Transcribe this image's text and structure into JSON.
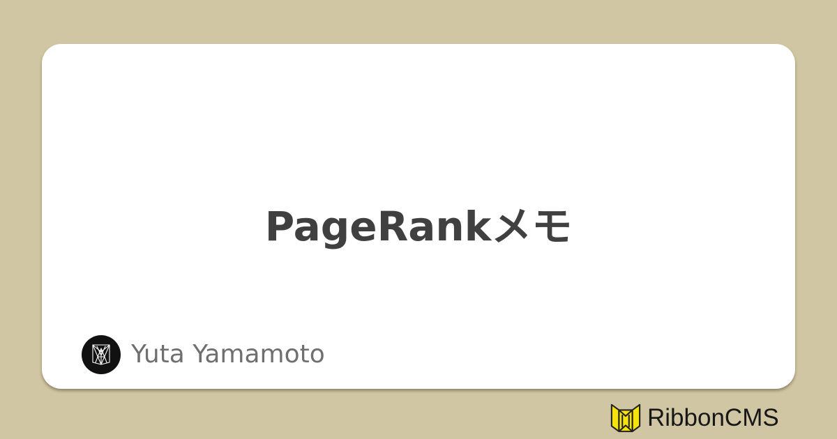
{
  "page": {
    "background_color": "#d1c6a3",
    "card_color": "#ffffff",
    "title_color": "#404040"
  },
  "article": {
    "title": "PageRankメモ"
  },
  "author": {
    "name": "Yuta Yamamoto",
    "avatar_icon": "geometric-monogram-logo-icon"
  },
  "brand": {
    "name": "RibbonCMS",
    "logo_icon": "yellow-ribbon-logo-icon",
    "logo_color": "#f6e20c"
  }
}
